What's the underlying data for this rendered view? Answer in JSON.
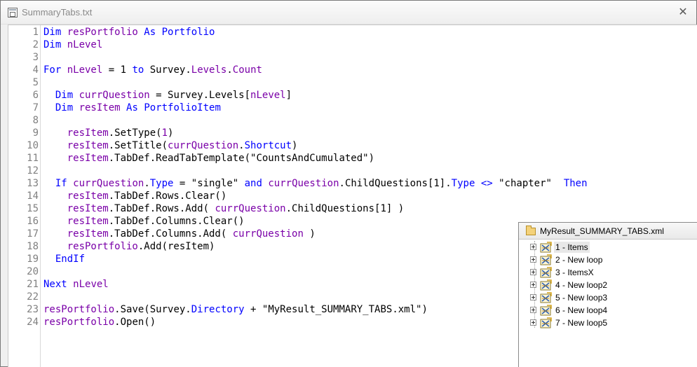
{
  "window": {
    "title": "SummaryTabs.txt",
    "close_glyph": "✕"
  },
  "editor": {
    "line_numbers": [
      "1",
      "2",
      "3",
      "4",
      "5",
      "6",
      "7",
      "8",
      "9",
      "10",
      "11",
      "12",
      "13",
      "14",
      "15",
      "16",
      "17",
      "18",
      "19",
      "20",
      "21",
      "22",
      "23",
      "24"
    ],
    "lines": [
      [
        {
          "t": "Dim ",
          "c": "kw"
        },
        {
          "t": "resPortfolio ",
          "c": "id"
        },
        {
          "t": "As ",
          "c": "kw"
        },
        {
          "t": "Portfolio",
          "c": "kw"
        }
      ],
      [
        {
          "t": "Dim ",
          "c": "kw"
        },
        {
          "t": "nLevel",
          "c": "id"
        }
      ],
      [],
      [
        {
          "t": "For ",
          "c": "kw"
        },
        {
          "t": "nLevel",
          "c": "id"
        },
        {
          "t": " = ",
          "c": "pl"
        },
        {
          "t": "1 ",
          "c": "pl"
        },
        {
          "t": "to ",
          "c": "kw"
        },
        {
          "t": "Survey.",
          "c": "pl"
        },
        {
          "t": "Levels",
          "c": "id"
        },
        {
          "t": ".",
          "c": "pl"
        },
        {
          "t": "Count",
          "c": "id"
        }
      ],
      [],
      [
        {
          "t": "  Dim ",
          "c": "kw"
        },
        {
          "t": "currQuestion",
          "c": "id"
        },
        {
          "t": " = Survey.Levels[",
          "c": "pl"
        },
        {
          "t": "nLevel",
          "c": "id"
        },
        {
          "t": "]",
          "c": "pl"
        }
      ],
      [
        {
          "t": "  Dim ",
          "c": "kw"
        },
        {
          "t": "resItem ",
          "c": "id"
        },
        {
          "t": "As ",
          "c": "kw"
        },
        {
          "t": "PortfolioItem",
          "c": "kw"
        }
      ],
      [],
      [
        {
          "t": "    resItem",
          "c": "id"
        },
        {
          "t": ".SetType(",
          "c": "pl"
        },
        {
          "t": "1",
          "c": "id"
        },
        {
          "t": ")",
          "c": "pl"
        }
      ],
      [
        {
          "t": "    resItem",
          "c": "id"
        },
        {
          "t": ".SetTitle(",
          "c": "pl"
        },
        {
          "t": "currQuestion",
          "c": "id"
        },
        {
          "t": ".",
          "c": "pl"
        },
        {
          "t": "Shortcut",
          "c": "kw"
        },
        {
          "t": ")",
          "c": "pl"
        }
      ],
      [
        {
          "t": "    resItem",
          "c": "id"
        },
        {
          "t": ".TabDef.ReadTabTemplate(",
          "c": "pl"
        },
        {
          "t": "\"CountsAndCumulated\"",
          "c": "str"
        },
        {
          "t": ")",
          "c": "pl"
        }
      ],
      [],
      [
        {
          "t": "  If ",
          "c": "kw"
        },
        {
          "t": "currQuestion",
          "c": "id"
        },
        {
          "t": ".",
          "c": "pl"
        },
        {
          "t": "Type",
          "c": "kw"
        },
        {
          "t": " = ",
          "c": "pl"
        },
        {
          "t": "\"single\"",
          "c": "str"
        },
        {
          "t": " and ",
          "c": "kw"
        },
        {
          "t": "currQuestion",
          "c": "id"
        },
        {
          "t": ".ChildQuestions[1].",
          "c": "pl"
        },
        {
          "t": "Type",
          "c": "kw"
        },
        {
          "t": " <> ",
          "c": "kw"
        },
        {
          "t": "\"chapter\"",
          "c": "str"
        },
        {
          "t": "  Then",
          "c": "kw"
        }
      ],
      [
        {
          "t": "    resItem",
          "c": "id"
        },
        {
          "t": ".TabDef.Rows.Clear()",
          "c": "pl"
        }
      ],
      [
        {
          "t": "    resItem",
          "c": "id"
        },
        {
          "t": ".TabDef.Rows.Add( ",
          "c": "pl"
        },
        {
          "t": "currQuestion",
          "c": "id"
        },
        {
          "t": ".ChildQuestions[1] )",
          "c": "pl"
        }
      ],
      [
        {
          "t": "    resItem",
          "c": "id"
        },
        {
          "t": ".TabDef.Columns.Clear()",
          "c": "pl"
        }
      ],
      [
        {
          "t": "    resItem",
          "c": "id"
        },
        {
          "t": ".TabDef.Columns.Add( ",
          "c": "pl"
        },
        {
          "t": "currQuestion",
          "c": "id"
        },
        {
          "t": " )",
          "c": "pl"
        }
      ],
      [
        {
          "t": "    resPortfolio",
          "c": "id"
        },
        {
          "t": ".Add(resItem)",
          "c": "pl"
        }
      ],
      [
        {
          "t": "  EndIf",
          "c": "kw"
        }
      ],
      [],
      [
        {
          "t": "Next ",
          "c": "kw"
        },
        {
          "t": "nLevel",
          "c": "id"
        }
      ],
      [],
      [
        {
          "t": "resPortfolio",
          "c": "id"
        },
        {
          "t": ".Save(Survey.",
          "c": "pl"
        },
        {
          "t": "Directory",
          "c": "kw"
        },
        {
          "t": " + ",
          "c": "pl"
        },
        {
          "t": "\"MyResult_SUMMARY_TABS.xml\"",
          "c": "str"
        },
        {
          "t": ")",
          "c": "pl"
        }
      ],
      [
        {
          "t": "resPortfolio",
          "c": "id"
        },
        {
          "t": ".Open()",
          "c": "pl"
        }
      ]
    ]
  },
  "result_panel": {
    "title": "MyResult_SUMMARY_TABS.xml",
    "items": [
      {
        "label": "1 - Items",
        "selected": true
      },
      {
        "label": "2 - New loop",
        "selected": false
      },
      {
        "label": "3 - ItemsX",
        "selected": false
      },
      {
        "label": "4 - New loop2",
        "selected": false
      },
      {
        "label": "5 - New loop3",
        "selected": false
      },
      {
        "label": "6 - New loop4",
        "selected": false
      },
      {
        "label": "7 - New loop5",
        "selected": false
      }
    ]
  },
  "colors": {
    "keyword": "#0000ff",
    "identifier": "#7a00a8",
    "plain": "#000000",
    "line_number": "#808080"
  }
}
